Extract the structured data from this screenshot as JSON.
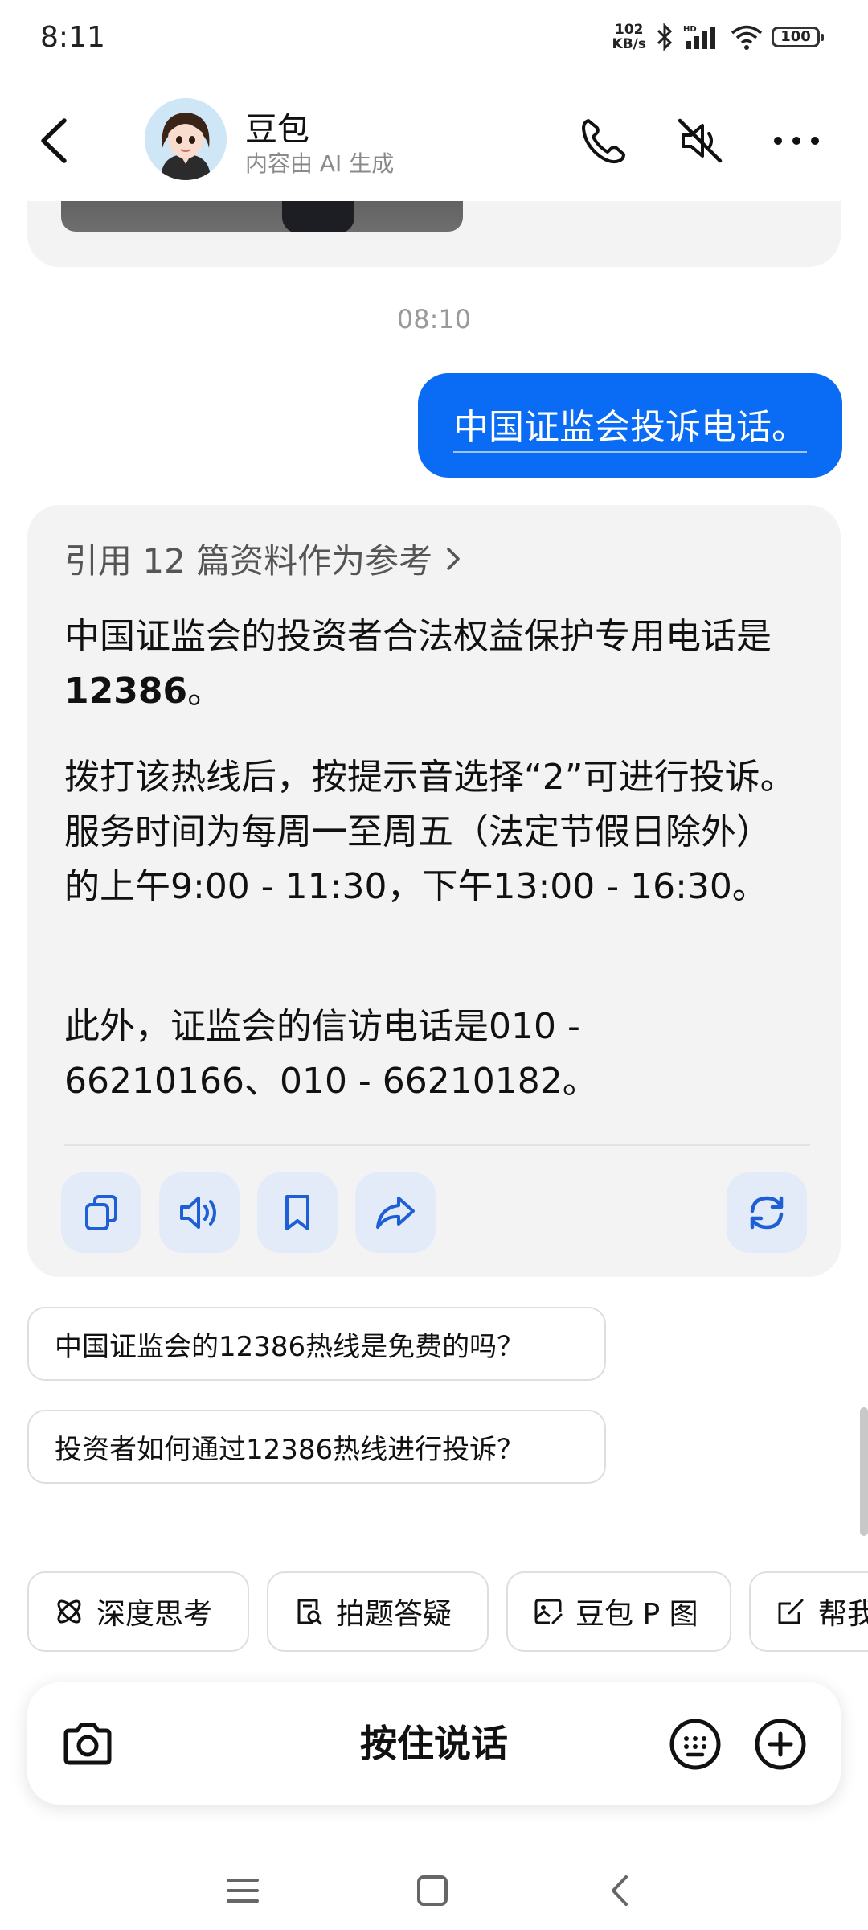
{
  "status_bar": {
    "time": "8:11",
    "net_speed_value": "102",
    "net_speed_unit": "KB/s",
    "battery": "100"
  },
  "header": {
    "bot_name": "豆包",
    "bot_subtitle": "内容由 AI 生成"
  },
  "chat": {
    "timestamp": "08:10",
    "user_message": "中国证监会投诉电话。",
    "ai_reply": {
      "reference_text": "引用 12 篇资料作为参考",
      "p1_a": "中国证监会的投资者合法权益保护专用电话是",
      "p1_bold": "12386",
      "p1_b": "。",
      "p2": "拨打该热线后，按提示音选择“2”可进行投诉。服务时间为每周一至周五（法定节假日除外）的上午9:00 - 11:30，下午13:00 - 16:30。",
      "p3": "此外，证监会的信访电话是010 - 66210166、010 - 66210182。"
    },
    "suggestions": [
      "中国证监会的12386热线是免费的吗？",
      "投资者如何通过12386热线进行投诉？"
    ]
  },
  "chips": [
    {
      "label": "深度思考",
      "icon": "atom-icon"
    },
    {
      "label": "拍题答疑",
      "icon": "doc-search-icon"
    },
    {
      "label": "豆包 P 图",
      "icon": "image-edit-icon"
    },
    {
      "label": "帮我",
      "icon": "edit-icon"
    }
  ],
  "input_bar": {
    "hold_to_talk": "按住说话"
  },
  "colors": {
    "accent": "#0a6cf5",
    "card_bg": "#f3f3f4",
    "action_bg": "#e3ebf8",
    "action_icon": "#1e5fd6"
  }
}
